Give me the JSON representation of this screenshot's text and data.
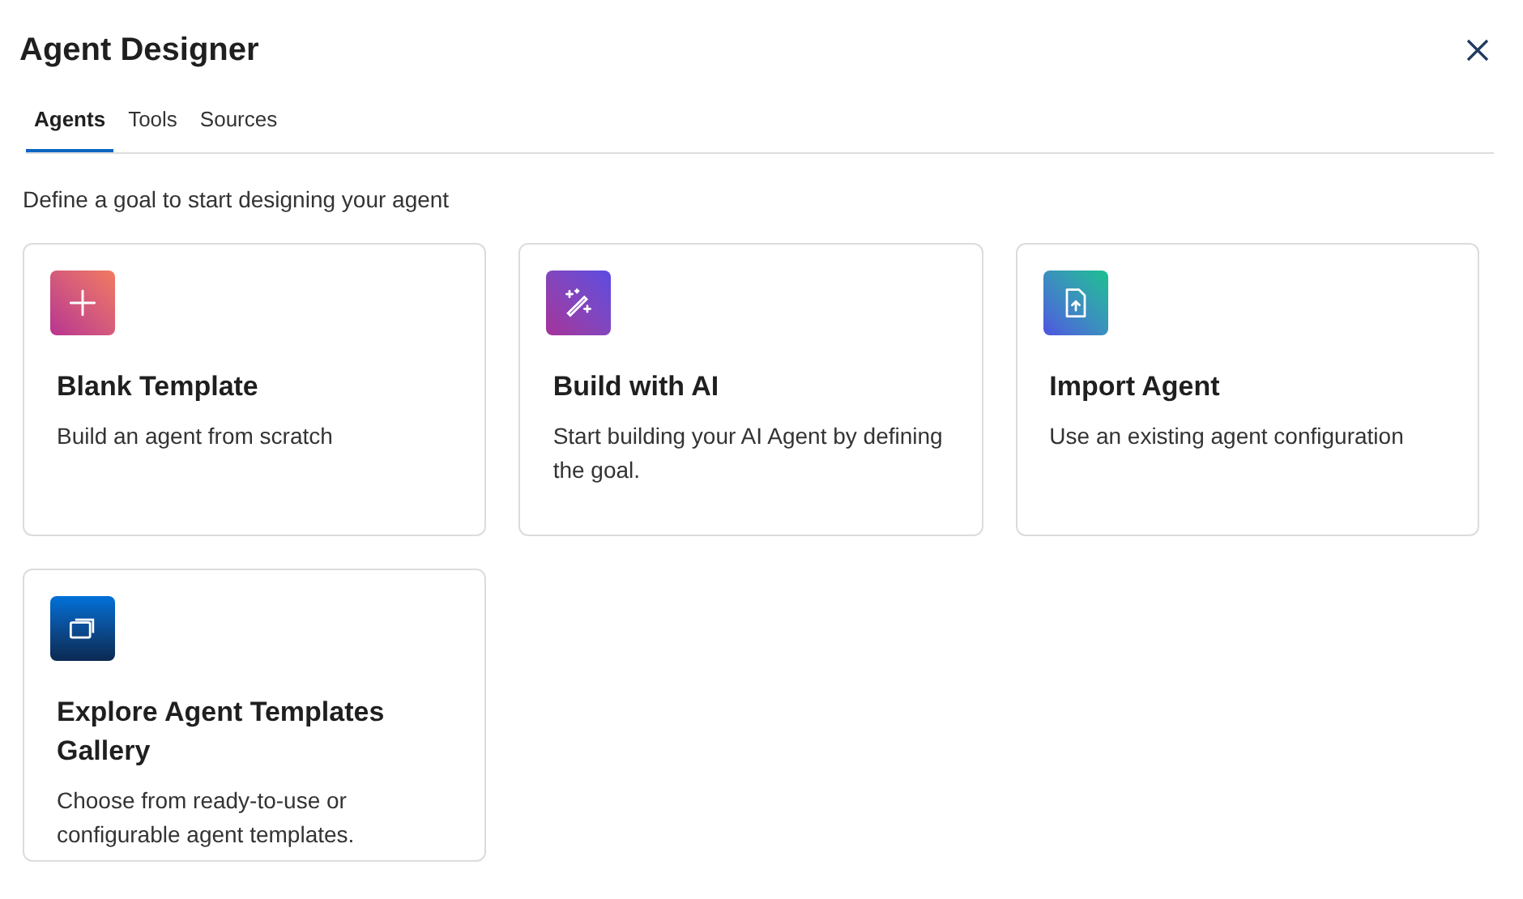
{
  "dialog": {
    "title": "Agent Designer"
  },
  "tabs": [
    {
      "label": "Agents",
      "selected": true
    },
    {
      "label": "Tools",
      "selected": false
    },
    {
      "label": "Sources",
      "selected": false
    }
  ],
  "intro": "Define a goal to start designing your agent",
  "cards": [
    {
      "kind": "blank",
      "title": "Blank Template",
      "description": "Build an agent from scratch"
    },
    {
      "kind": "ai",
      "title": "Build with AI",
      "description": "Start building your AI Agent by defining the goal."
    },
    {
      "kind": "import",
      "title": "Import Agent",
      "description": "Use an existing agent configuration"
    },
    {
      "kind": "gallery",
      "title": "Explore Agent Templates Gallery",
      "description": "Choose from ready-to-use or configurable agent templates."
    }
  ]
}
